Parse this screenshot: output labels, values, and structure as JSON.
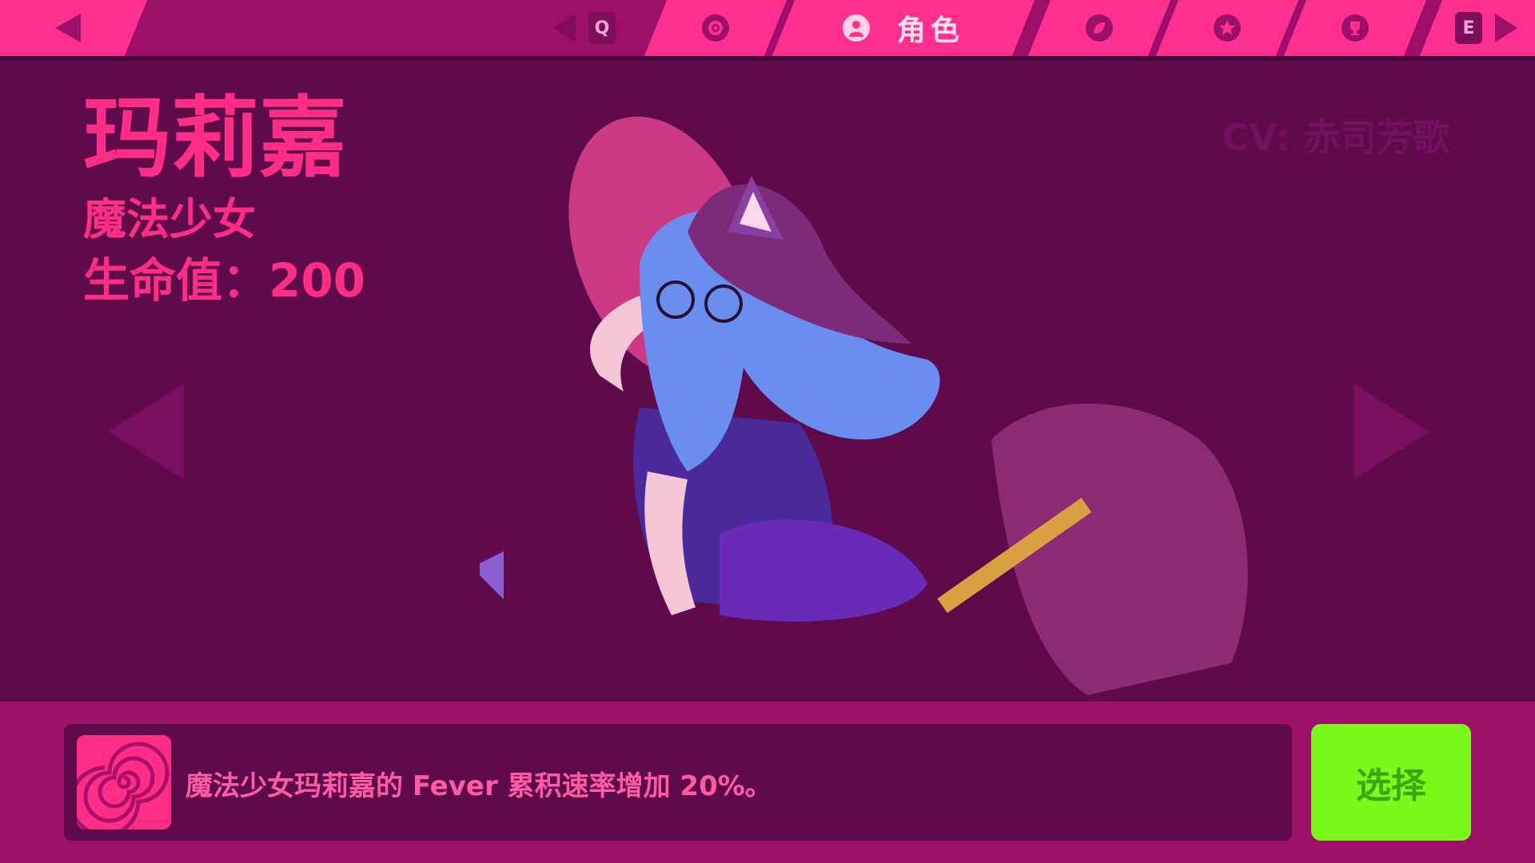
{
  "nav": {
    "character_tab_label": "角色",
    "key_hint_left": "Q",
    "key_hint_right": "E"
  },
  "character": {
    "name": "玛莉嘉",
    "title": "魔法少女",
    "hp_label": "生命值：200",
    "cv_label": "CV: 赤司芳歌"
  },
  "skill": {
    "icon": "spiral-icon",
    "description": "魔法少女玛莉嘉的 Fever 累积速率增加 20%。"
  },
  "actions": {
    "select_label": "选择"
  },
  "colors": {
    "background": "#5e0a4b",
    "nav_bar": "#9c1069",
    "nav_tab": "#ff2f8f",
    "accent_text": "#ff2d86",
    "select_button": "#7cf91a"
  }
}
